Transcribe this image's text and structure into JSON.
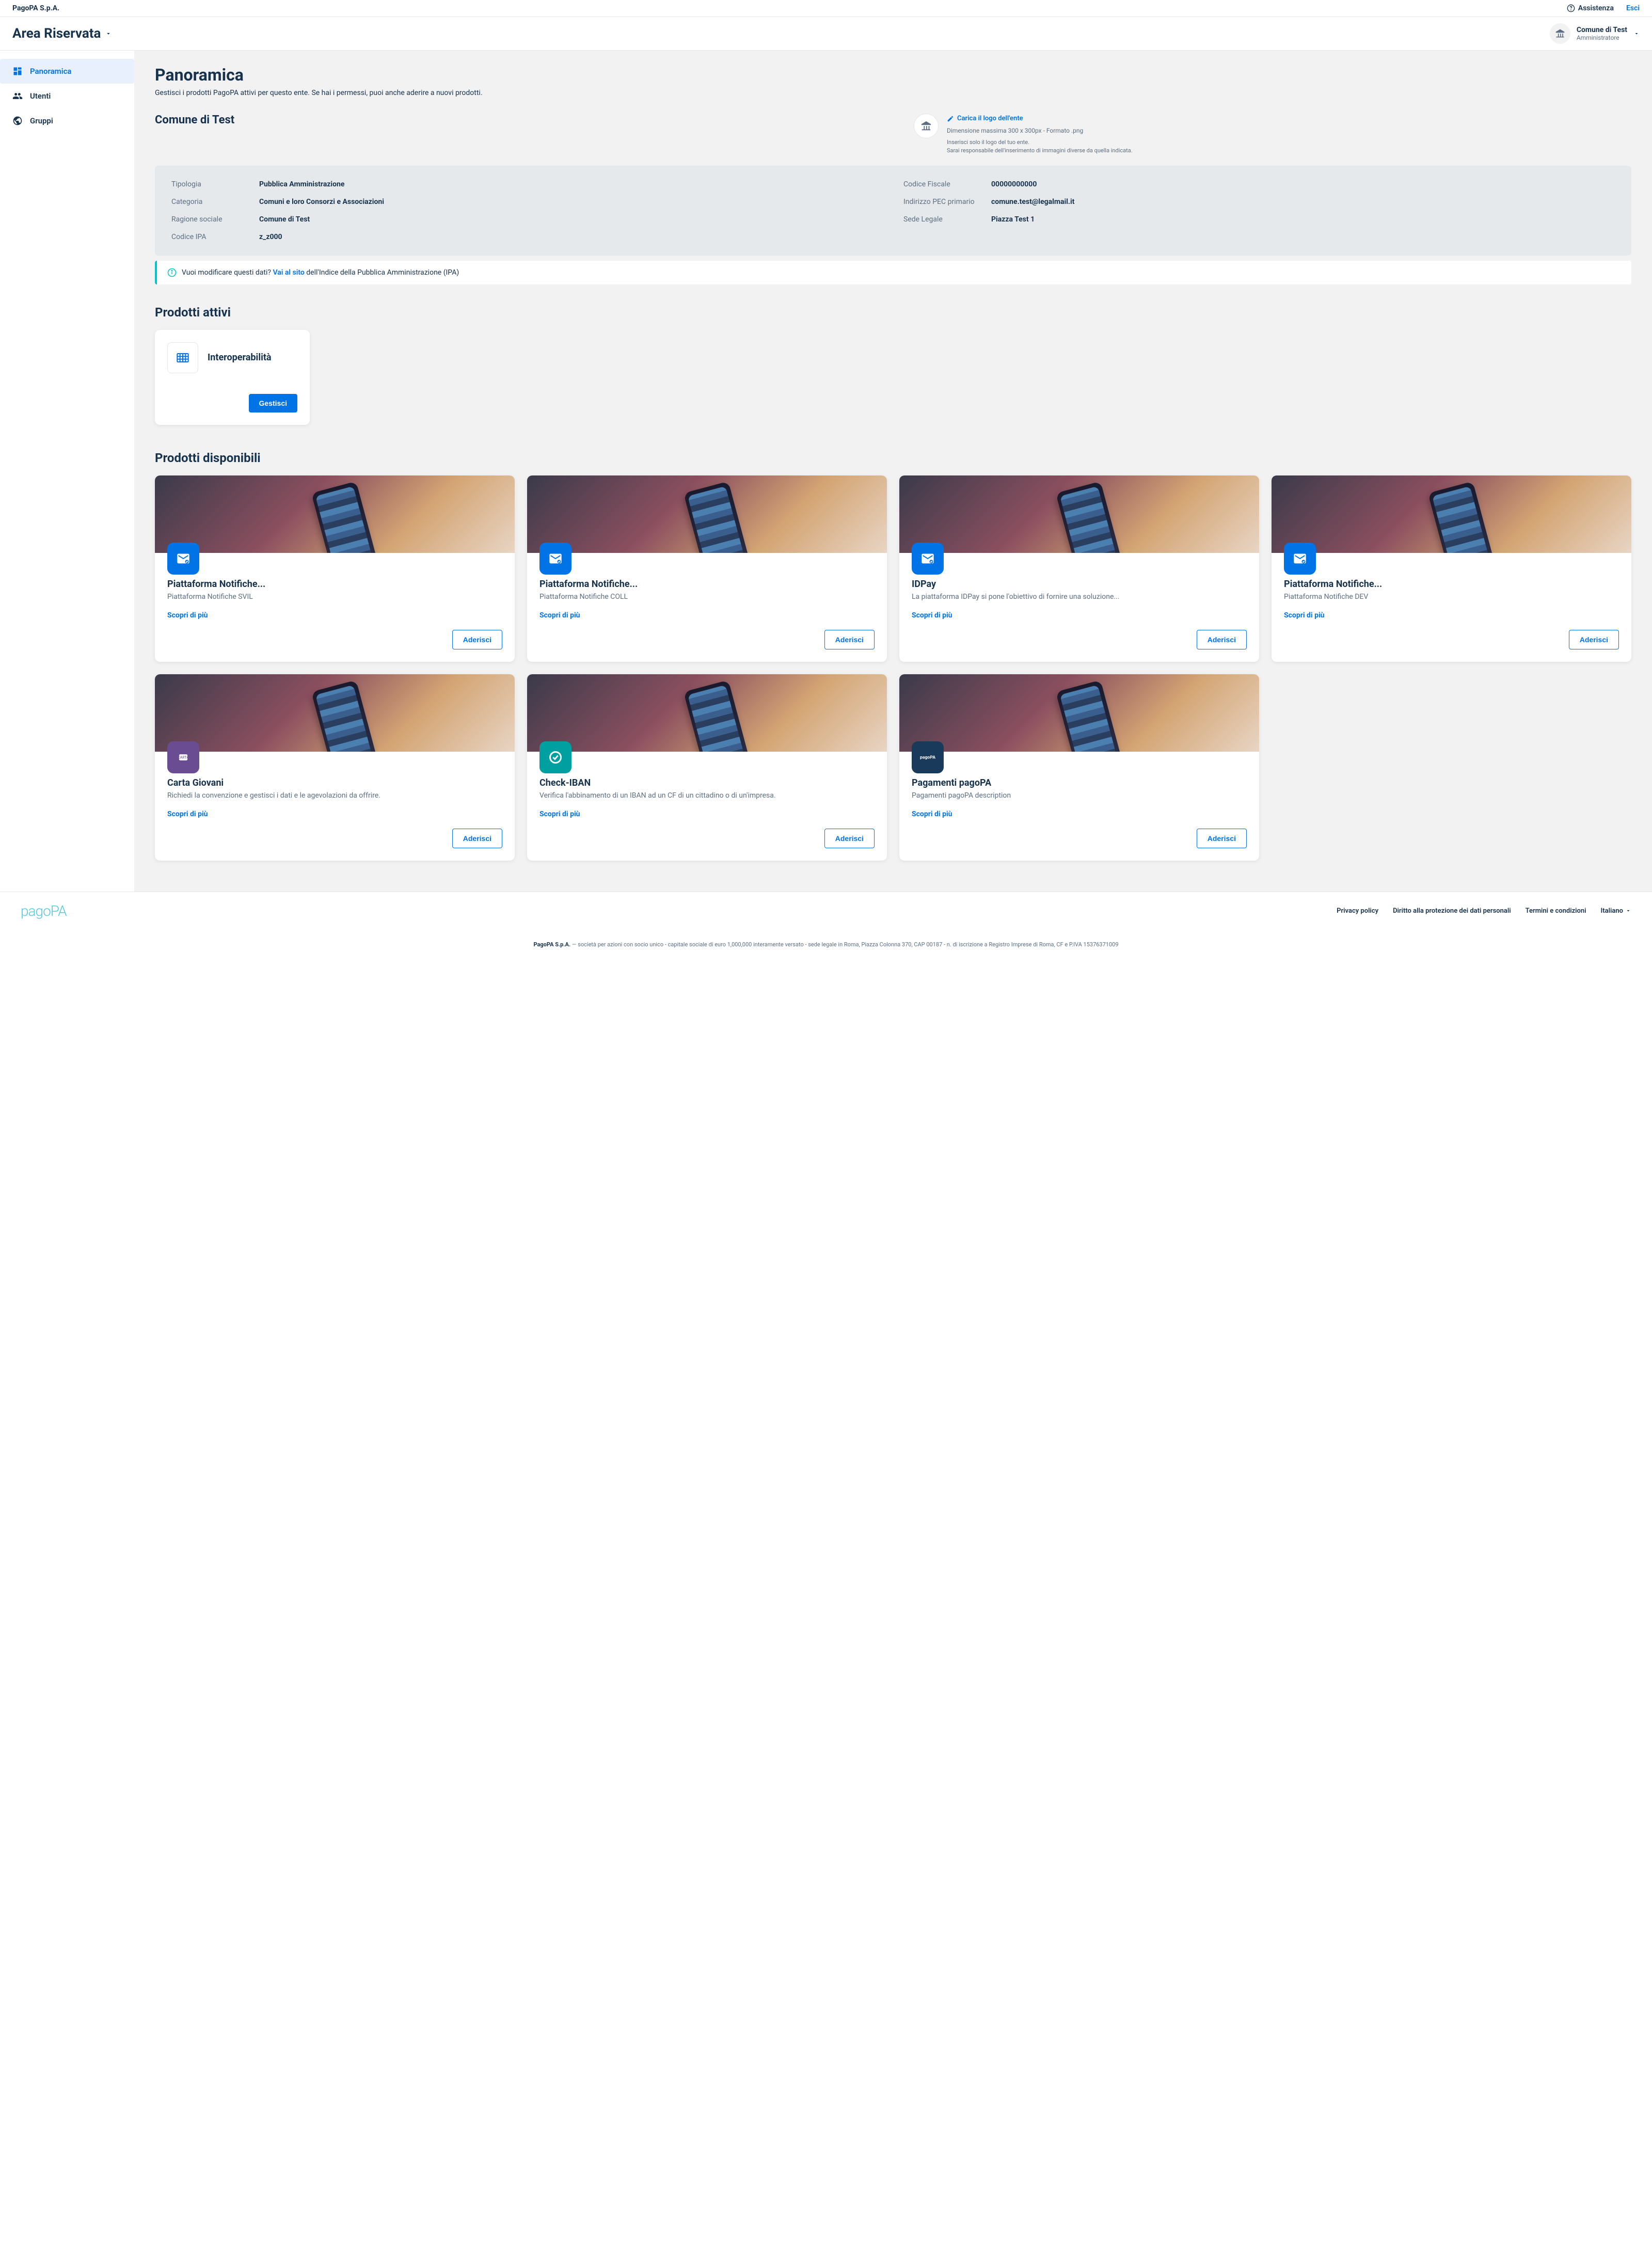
{
  "topbar": {
    "company": "PagoPA S.p.A.",
    "assist": "Assistenza",
    "exit": "Esci"
  },
  "header": {
    "title": "Area Riservata",
    "inst_name": "Comune di Test",
    "inst_role": "Amministratore"
  },
  "sidebar": {
    "items": [
      {
        "label": "Panoramica"
      },
      {
        "label": "Utenti"
      },
      {
        "label": "Gruppi"
      }
    ]
  },
  "page": {
    "title": "Panoramica",
    "subtitle": "Gestisci i prodotti PagoPA attivi per questo ente. Se hai i permessi, puoi anche aderire a nuovi prodotti."
  },
  "ente": {
    "name": "Comune di Test",
    "upload_link": "Carica il logo dell'ente",
    "upload_hint1": "Dimensione massima 300 x 300px - Formato .png",
    "upload_hint2": "Inserisci solo il logo del tuo ente.",
    "upload_hint3": "Sarai responsabile dell'inserimento di immagini diverse da quella indicata."
  },
  "info": {
    "tipologia_label": "Tipologia",
    "tipologia_value": "Pubblica Amministrazione",
    "categoria_label": "Categoria",
    "categoria_value": "Comuni e loro Consorzi e Associazioni",
    "ragione_label": "Ragione sociale",
    "ragione_value": "Comune di Test",
    "ipa_label": "Codice IPA",
    "ipa_value": "z_z000",
    "cf_label": "Codice Fiscale",
    "cf_value": "00000000000",
    "pec_label": "Indirizzo PEC primario",
    "pec_value": "comune.test@legalmail.it",
    "sede_label": "Sede Legale",
    "sede_value": "Piazza Test 1"
  },
  "alert": {
    "prefix": "Vuoi modificare questi dati? ",
    "link": "Vai al sito",
    "suffix": " dell'Indice della Pubblica Amministrazione (IPA)"
  },
  "active": {
    "title": "Prodotti attivi",
    "prod_name": "Interoperabilità",
    "manage": "Gestisci"
  },
  "available": {
    "title": "Prodotti disponibili",
    "learn_more": "Scopri di più",
    "join": "Aderisci",
    "products": [
      {
        "title": "Piattaforma Notifiche...",
        "desc": "Piattaforma Notifiche SVIL",
        "badge": "blue"
      },
      {
        "title": "Piattaforma Notifiche...",
        "desc": "Piattaforma Notifiche COLL",
        "badge": "blue"
      },
      {
        "title": "IDPay",
        "desc": "La piattaforma IDPay si pone l'obiettivo di fornire una soluzione...",
        "badge": "blue"
      },
      {
        "title": "Piattaforma Notifiche...",
        "desc": "Piattaforma Notifiche DEV",
        "badge": "blue"
      },
      {
        "title": "Carta Giovani",
        "desc": "Richiedi la convenzione e gestisci i dati e le agevolazioni da offrire.",
        "badge": "purple"
      },
      {
        "title": "Check-IBAN",
        "desc": "Verifica l'abbinamento di un IBAN ad un CF di un cittadino o di un'impresa.",
        "badge": "teal"
      },
      {
        "title": "Pagamenti pagoPA",
        "desc": "Pagamenti pagoPA description",
        "badge": "navy"
      }
    ]
  },
  "footer": {
    "privacy": "Privacy policy",
    "data": "Diritto alla protezione dei dati personali",
    "terms": "Termini e condizioni",
    "lang": "Italiano",
    "company": "PagoPA S.p.A.",
    "legal": " — società per azioni con socio unico - capitale sociale di euro 1,000,000 interamente versato - sede legale in Roma, Piazza Colonna 370, CAP 00187 - n. di iscrizione a Registro Imprese di Roma, CF e P.IVA 15376371009"
  }
}
